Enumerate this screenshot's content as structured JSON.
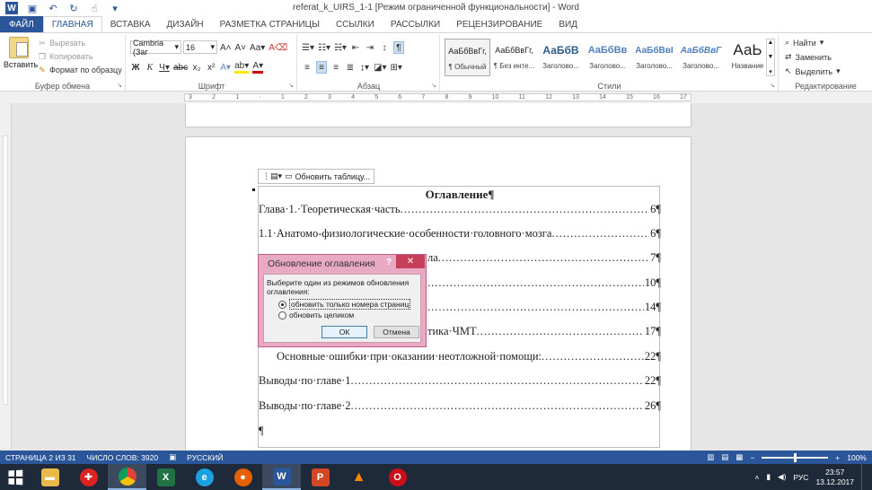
{
  "window": {
    "title": "referat_k_UIRS_1-1 [Режим ограниченной функциональности] - Word",
    "controls": [
      "?",
      "▭",
      "—",
      "▭",
      "✕"
    ]
  },
  "tabs": [
    "ФАЙЛ",
    "ГЛАВНАЯ",
    "ВСТАВКА",
    "ДИЗАЙН",
    "РАЗМЕТКА СТРАНИЦЫ",
    "ССЫЛКИ",
    "РАССЫЛКИ",
    "РЕЦЕНЗИРОВАНИЕ",
    "ВИД"
  ],
  "ribbon": {
    "clipboard": {
      "paste": "Вставить",
      "cut": "Вырезать",
      "copy": "Копировать",
      "format_painter": "Формат по образцу",
      "label": "Буфер обмена"
    },
    "font": {
      "name": "Cambria (Заг",
      "size": "16",
      "label": "Шрифт"
    },
    "paragraph": {
      "label": "Абзац"
    },
    "styles": {
      "label": "Стили",
      "items": [
        {
          "sample": "АаБбВвГг,",
          "name": "¶ Обычный"
        },
        {
          "sample": "АаБбВвГг,",
          "name": "¶ Без инте..."
        },
        {
          "sample": "АаБбВ",
          "name": "Заголово..."
        },
        {
          "sample": "АаБбВв",
          "name": "Заголово..."
        },
        {
          "sample": "АаБбВвІ",
          "name": "Заголово..."
        },
        {
          "sample": "АаБбВвГ",
          "name": "Заголово..."
        },
        {
          "sample": "АаЬ",
          "name": "Название"
        }
      ]
    },
    "editing": {
      "label": "Редактирование",
      "find": "Найти",
      "replace": "Заменить",
      "select": "Выделить"
    }
  },
  "ruler": {
    "ticks": [
      "3",
      "2",
      "1",
      "",
      "1",
      "2",
      "3",
      "4",
      "5",
      "6",
      "7",
      "8",
      "9",
      "10",
      "11",
      "12",
      "13",
      "14",
      "15",
      "16",
      "17"
    ]
  },
  "toc_toolbar": {
    "update_label": "Обновить таблицу..."
  },
  "document": {
    "toc_title": "Оглавление¶",
    "entries": [
      {
        "text": "Глава·1.·Теоретическая·часть",
        "page": "6¶"
      },
      {
        "text": "1.1·Анатомо-физиологические·особенности·головного·мозга",
        "page": "6¶"
      },
      {
        "text": "ла",
        "page": "7¶"
      },
      {
        "text": "",
        "page": "10¶"
      },
      {
        "text": "",
        "page": "14¶"
      },
      {
        "text": "тика·ЧМТ",
        "page": "17¶"
      },
      {
        "text": "Основные·ошибки·при·оказании·неотложной·помощи:",
        "page": "22¶"
      },
      {
        "text": "Выводы·по·главе·1",
        "page": "22¶"
      },
      {
        "text": "Выводы·по·главе·2",
        "page": "26¶"
      }
    ],
    "trailing_mark": "¶"
  },
  "dialog": {
    "title": "Обновление оглавления",
    "help": "?",
    "close": "✕",
    "message": "Выберите один из режимов обновления оглавления:",
    "option1": "обновить только номера страниц",
    "option2": "обновить целиком",
    "ok": "ОК",
    "cancel": "Отмена"
  },
  "status": {
    "page": "СТРАНИЦА 2 ИЗ 31",
    "words": "ЧИСЛО СЛОВ: 3920",
    "language": "РУССКИЙ",
    "zoom": "100%",
    "zoom_level": 0.5
  },
  "taskbar": {
    "apps": [
      "explorer",
      "daemon-tools",
      "chrome",
      "excel",
      "ie",
      "firefox",
      "word",
      "powerpoint",
      "vlc",
      "opera"
    ],
    "lang": "РУС",
    "time": "23:57",
    "date": "13.12.2017"
  }
}
